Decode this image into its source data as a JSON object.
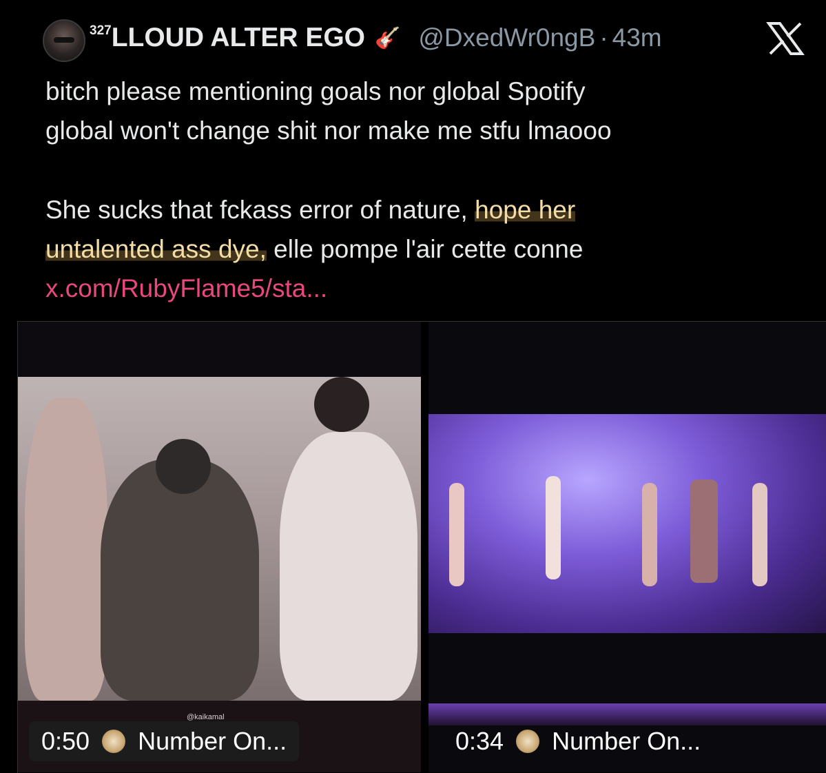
{
  "tweet": {
    "name_prefix": "327",
    "display_name": "LLOUD ALTER EGO",
    "name_emoji": "🎸",
    "handle": "@DxedWr0ngB",
    "separator": "·",
    "time": "43m",
    "x_logo": "x-logo-icon",
    "line1": "bitch please mentioning goals nor global Spotify",
    "line2": "global won't change shit nor make me stfu lmaooo",
    "line3_pre": "She sucks that fckass error of nature, ",
    "line3_hl": "hope her",
    "line4_hl": "untalented ass dye,",
    "line4_post": " elle pompe l'air cette conne",
    "link": "x.com/RubyFlame5/sta..."
  },
  "media": [
    {
      "duration": "0:50",
      "title": "Number On...",
      "watermark": "@kaikamal"
    },
    {
      "duration": "0:34",
      "title": "Number On..."
    }
  ],
  "colors": {
    "background": "#000000",
    "text": "#e7e9ea",
    "muted": "#8b98a5",
    "link": "#e8477f",
    "highlight": "#f4dca6"
  }
}
